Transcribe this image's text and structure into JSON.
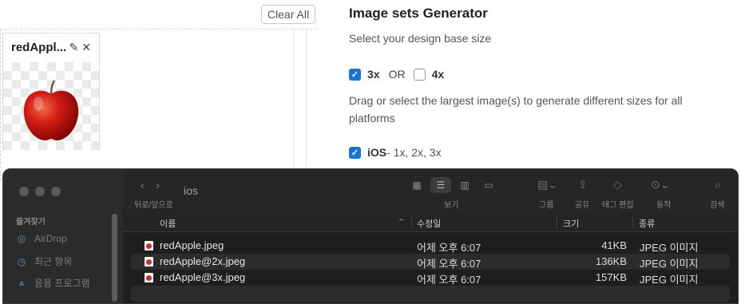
{
  "web": {
    "clear_all": "Clear All",
    "card": {
      "title": "redAppl...",
      "edit_icon": "✎",
      "close_icon": "✕"
    },
    "generator": {
      "title": "Image sets Generator",
      "subtitle": "Select your design base size",
      "opt_3x": "3x",
      "or": "OR",
      "opt_4x": "4x",
      "description": "Drag or select the largest image(s) to generate different sizes for all platforms",
      "ios_label": "iOS",
      "ios_sizes": " - 1x, 2x, 3x"
    },
    "colors": {
      "accent": "#1a73d9"
    }
  },
  "finder": {
    "title": "ios",
    "nav_caption": "뒤로/앞으로",
    "view_caption": "보기",
    "group_caption": "그룹",
    "share_caption": "공유",
    "tag_caption": "태그 편집",
    "action_caption": "동작",
    "search_caption": "검색",
    "sidebar": {
      "favorites_header": "즐겨찾기",
      "items": [
        {
          "label": "AirDrop",
          "icon": "airdrop-icon"
        },
        {
          "label": "최근 항목",
          "icon": "clock-icon"
        },
        {
          "label": "응용 프로그램",
          "icon": "applications-icon"
        }
      ]
    },
    "columns": {
      "name": "이름",
      "modified": "수정일",
      "size": "크기",
      "kind": "종류"
    },
    "files": [
      {
        "name": "redApple.jpeg",
        "modified": "어제 오후 6:07",
        "size": "41KB",
        "kind": "JPEG 이미지"
      },
      {
        "name": "redApple@2x.jpeg",
        "modified": "어제 오후 6:07",
        "size": "136KB",
        "kind": "JPEG 이미지"
      },
      {
        "name": "redApple@3x.jpeg",
        "modified": "어제 오후 6:07",
        "size": "157KB",
        "kind": "JPEG 이미지"
      }
    ]
  }
}
